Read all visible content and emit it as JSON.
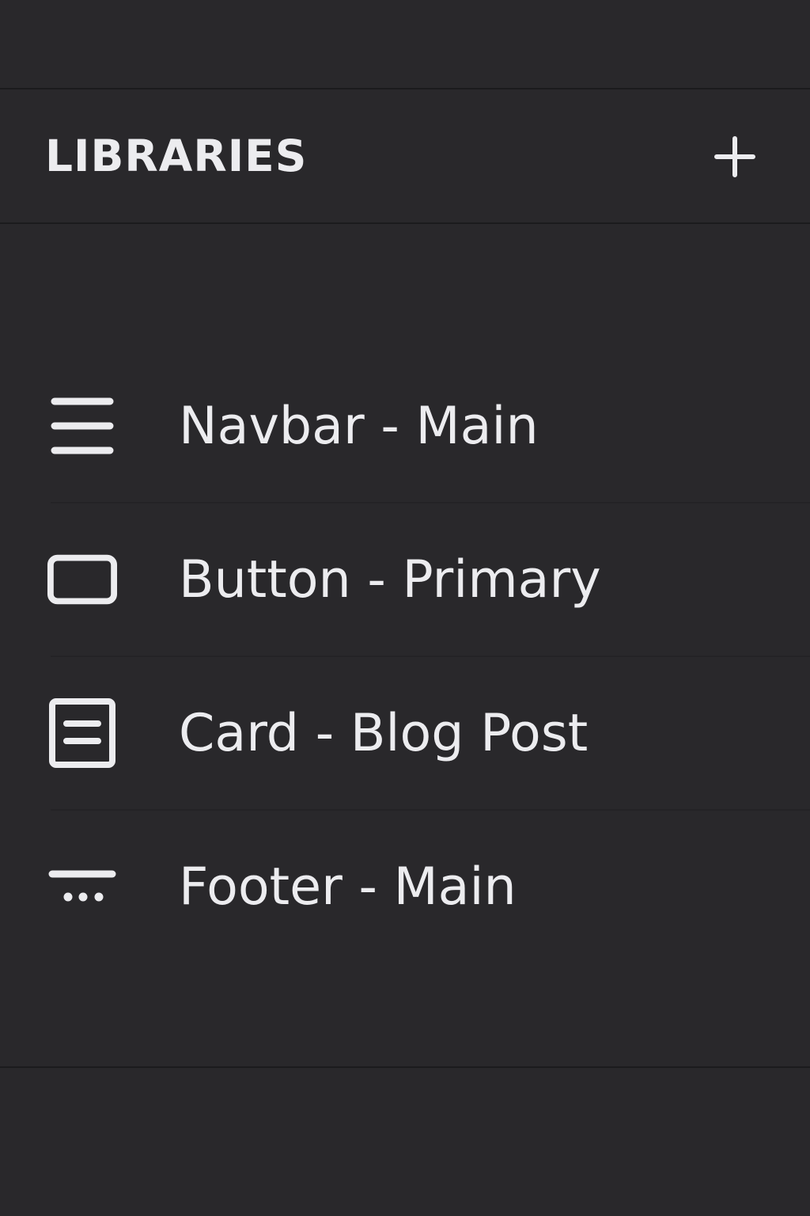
{
  "libraries": {
    "title": "LIBRARIES",
    "add_icon": "plus-icon",
    "items": [
      {
        "label": "Navbar - Main",
        "icon": "navbar-icon"
      },
      {
        "label": "Button - Primary",
        "icon": "button-icon"
      },
      {
        "label": "Card - Blog Post",
        "icon": "card-icon"
      },
      {
        "label": "Footer - Main",
        "icon": "footer-icon"
      }
    ]
  },
  "colors": {
    "background": "#29282b",
    "text": "#ececef",
    "divider": "#1b1b1d"
  }
}
